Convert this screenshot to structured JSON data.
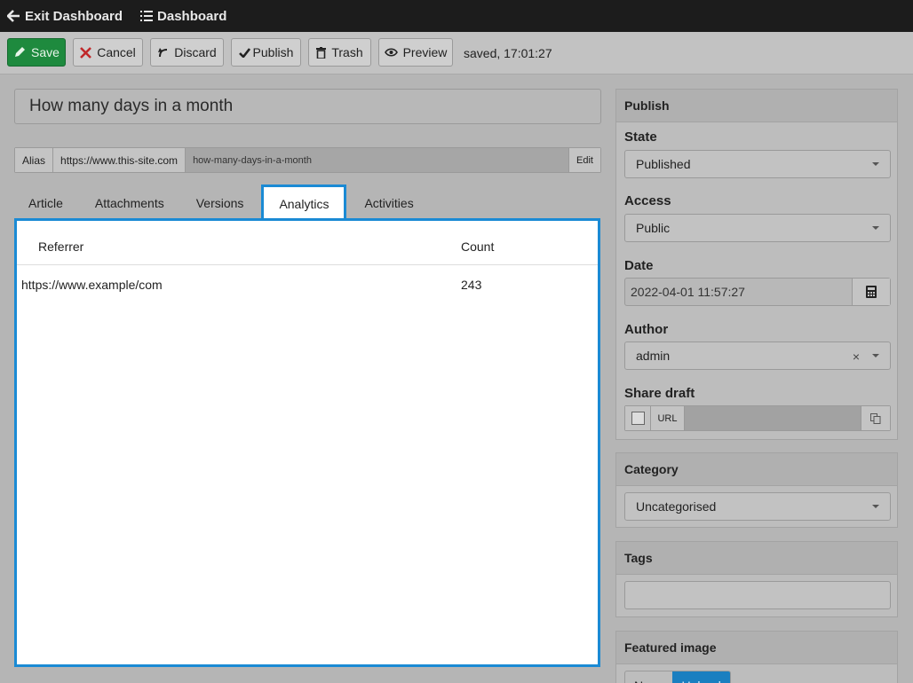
{
  "topbar": {
    "exit_label": "Exit Dashboard",
    "dashboard_label": "Dashboard"
  },
  "toolbar": {
    "save_label": "Save",
    "cancel_label": "Cancel",
    "discard_label": "Discard",
    "publish_label": "Publish",
    "trash_label": "Trash",
    "preview_label": "Preview",
    "status_text": "saved, 17:01:27"
  },
  "article": {
    "title": "How many days in a month",
    "alias_label": "Alias",
    "alias_base": "https://www.this-site.com",
    "alias_slug": "how-many-days-in-a-month",
    "alias_edit": "Edit"
  },
  "tabs": [
    {
      "label": "Article",
      "active": false
    },
    {
      "label": "Attachments",
      "active": false
    },
    {
      "label": "Versions",
      "active": false
    },
    {
      "label": "Analytics",
      "active": true
    },
    {
      "label": "Activities",
      "active": false
    }
  ],
  "analytics": {
    "columns": [
      "Referrer",
      "Count"
    ],
    "rows": [
      [
        "https://www.example/com",
        "243"
      ]
    ]
  },
  "sidebar": {
    "publish": {
      "header": "Publish",
      "state_label": "State",
      "state_value": "Published",
      "access_label": "Access",
      "access_value": "Public",
      "date_label": "Date",
      "date_value": "2022-04-01 11:57:27",
      "author_label": "Author",
      "author_value": "admin",
      "author_clear": "×",
      "share_label": "Share draft",
      "share_url_label": "URL"
    },
    "category": {
      "header": "Category",
      "value": "Uncategorised"
    },
    "tags": {
      "header": "Tags"
    },
    "featured": {
      "header": "Featured image",
      "options": [
        "None",
        "Upload"
      ],
      "selected": "Upload"
    }
  },
  "colors": {
    "accent": "#1a8ad4",
    "save_green": "#1e8a3e",
    "topbar": "#1c1c1c"
  }
}
